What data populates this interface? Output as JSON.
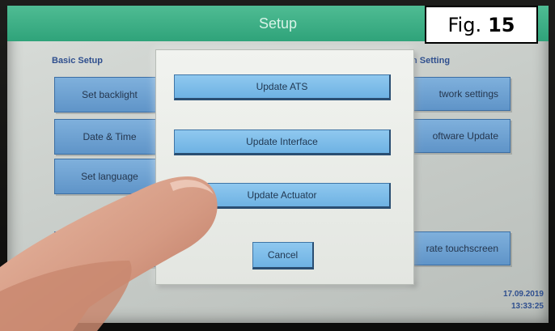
{
  "app": {
    "title": "Setup"
  },
  "figure_label": {
    "prefix": "Fig.",
    "number": "15"
  },
  "background": {
    "left_section_title": "Basic Setup",
    "right_section_title": "n Setting",
    "left_buttons": [
      "Set backlight",
      "Date & Time",
      "Set language"
    ],
    "right_buttons": [
      "twork settings",
      "oftware Update",
      "rate touchscreen"
    ]
  },
  "dialog": {
    "buttons": [
      "Update ATS",
      "Update Interface",
      "Update Actuator"
    ],
    "cancel_label": "Cancel"
  },
  "status": {
    "date": "17.09.2019",
    "time": "13:33:25"
  },
  "colors": {
    "titlebar": "#2fa37a",
    "button_blue": "#6eb2e3",
    "section_text": "#2f4f8e"
  }
}
